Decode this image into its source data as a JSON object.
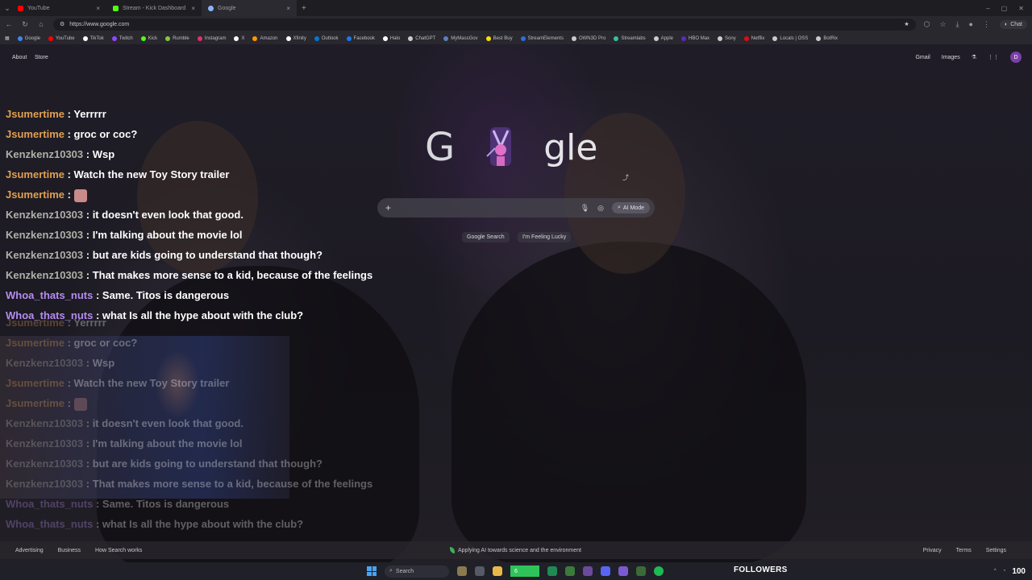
{
  "tabs": [
    {
      "label": "YouTube",
      "color": "#ff0000",
      "active": false
    },
    {
      "label": "Stream - Kick Dashboard",
      "color": "#53fc18",
      "active": false
    },
    {
      "label": "Google",
      "color": "#8ab4f8",
      "active": true
    }
  ],
  "address": {
    "url": "https://www.google.com"
  },
  "browser": {
    "chat_label": "Chat"
  },
  "bookmarks": [
    {
      "label": "Google",
      "color": "#4285f4"
    },
    {
      "label": "YouTube",
      "color": "#ff0000"
    },
    {
      "label": "TikTok",
      "color": "#ffffff"
    },
    {
      "label": "Twitch",
      "color": "#9146ff"
    },
    {
      "label": "Kick",
      "color": "#53fc18"
    },
    {
      "label": "Rumble",
      "color": "#85c742"
    },
    {
      "label": "Instagram",
      "color": "#e1306c"
    },
    {
      "label": "X",
      "color": "#ffffff"
    },
    {
      "label": "Amazon",
      "color": "#ff9900"
    },
    {
      "label": "Xfinity",
      "color": "#ffffff"
    },
    {
      "label": "Outlook",
      "color": "#0078d4"
    },
    {
      "label": "Facebook",
      "color": "#1877f2"
    },
    {
      "label": "Halo",
      "color": "#ffffff"
    },
    {
      "label": "ChatGPT",
      "color": "#cccccc"
    },
    {
      "label": "MyMassGov",
      "color": "#5b7fbf"
    },
    {
      "label": "Best Buy",
      "color": "#ffe000"
    },
    {
      "label": "StreamElements",
      "color": "#2d6cdf"
    },
    {
      "label": "OWN3D Pro",
      "color": "#cccccc"
    },
    {
      "label": "Streamlabs",
      "color": "#31c3a2"
    },
    {
      "label": "Apple",
      "color": "#cccccc"
    },
    {
      "label": "HBO Max",
      "color": "#5b2bbf"
    },
    {
      "label": "Sony",
      "color": "#cccccc"
    },
    {
      "label": "Netflix",
      "color": "#e50914"
    },
    {
      "label": "Locals | OSS",
      "color": "#cccccc"
    },
    {
      "label": "BotRix",
      "color": "#cccccc"
    }
  ],
  "google": {
    "about": "About",
    "store": "Store",
    "gmail": "Gmail",
    "images": "Images",
    "avatar_letter": "D",
    "logo_first": "G",
    "logo_rest": "gle",
    "ai_mode": "AI Mode",
    "search_button": "Google Search",
    "lucky_button": "I'm Feeling Lucky"
  },
  "chat": [
    {
      "user": "Jsumertime",
      "color": "#e0a050",
      "text": "Yerrrrr"
    },
    {
      "user": "Jsumertime",
      "color": "#e0a050",
      "text": "groc or coc?"
    },
    {
      "user": "Kenzkenz10303",
      "color": "#b0b0a8",
      "text": "Wsp"
    },
    {
      "user": "Jsumertime",
      "color": "#e0a050",
      "text": "Watch the new Toy Story trailer"
    },
    {
      "user": "Jsumertime",
      "color": "#e0a050",
      "text": "",
      "emote": true
    },
    {
      "user": "Kenzkenz10303",
      "color": "#b0b0a8",
      "text": "it doesn't even look that good."
    },
    {
      "user": "Kenzkenz10303",
      "color": "#b0b0a8",
      "text": "I'm talking about the movie lol"
    },
    {
      "user": "Kenzkenz10303",
      "color": "#b0b0a8",
      "text": "but are kids going to understand that though?"
    },
    {
      "user": "Kenzkenz10303",
      "color": "#b0b0a8",
      "text": "That makes more sense to a kid, because of the feelings"
    },
    {
      "user": "Whoa_thats_nuts",
      "color": "#b48cf0",
      "text": "Same. Titos is dangerous"
    },
    {
      "user": "Whoa_thats_nuts",
      "color": "#b48cf0",
      "text": "what Is all the hype about with the club?"
    }
  ],
  "footer": {
    "advertising": "Advertising",
    "business": "Business",
    "how_search_works": "How Search works",
    "center": "Applying AI towards science and the environment",
    "privacy": "Privacy",
    "terms": "Terms",
    "settings": "Settings"
  },
  "taskbar": {
    "search": "Search",
    "green_value": "6",
    "followers_label": "FOLLOWERS",
    "followers_count": "100"
  }
}
